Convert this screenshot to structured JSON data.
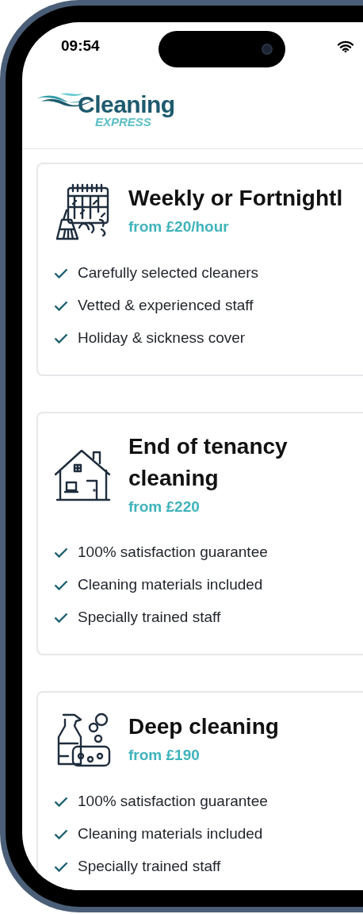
{
  "status_bar": {
    "time": "09:54"
  },
  "logo": {
    "name": "Cleaning",
    "tagline": "EXPRESS"
  },
  "services": [
    {
      "title": "Weekly or Fortnightl",
      "price": "from £20/hour",
      "features": [
        "Carefully selected cleaners",
        "Vetted & experienced staff",
        "Holiday & sickness cover"
      ]
    },
    {
      "title": "End of tenancy cleaning",
      "price": "from £220",
      "features": [
        "100% satisfaction guarantee",
        "Cleaning materials included",
        "Specially trained staff"
      ]
    },
    {
      "title": "Deep cleaning",
      "price": "from £190",
      "features": [
        "100% satisfaction guarantee",
        "Cleaning materials included",
        "Specially trained staff"
      ]
    }
  ]
}
